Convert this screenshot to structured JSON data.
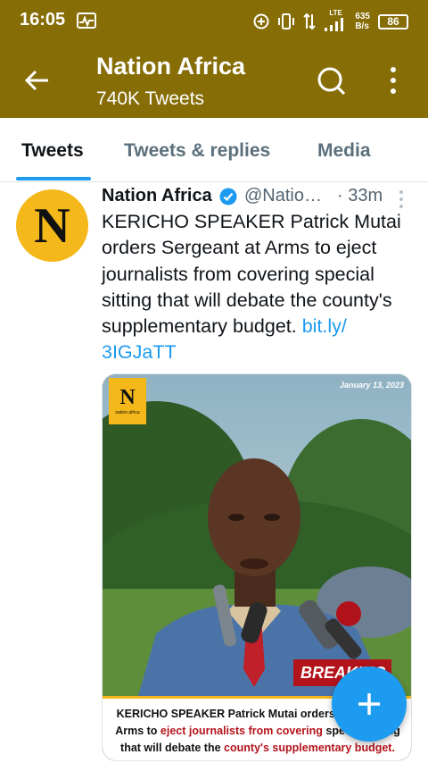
{
  "status_bar": {
    "time": "16:05",
    "network_type": "LTE",
    "speed_value": "635",
    "speed_unit": "B/s",
    "battery": "86",
    "icons": [
      "activity-icon",
      "add-circle-icon",
      "vibrate-icon",
      "data-arrows-icon",
      "signal-icon"
    ]
  },
  "app_bar": {
    "title": "Nation Africa",
    "subtitle": "740K Tweets",
    "icons": [
      "back-arrow-icon",
      "search-icon",
      "more-vertical-icon"
    ]
  },
  "tabs": [
    {
      "label": "Tweets",
      "active": true
    },
    {
      "label": "Tweets & replies",
      "active": false
    },
    {
      "label": "Media",
      "active": false
    }
  ],
  "tweet": {
    "avatar_letter": "N",
    "author": "Nation Africa",
    "handle": "@Natio…",
    "separator": "·",
    "time_ago": "33m",
    "text_line1": "KERICHO SPEAKER Patrick Mutai",
    "text_line2": "orders Sergeant at Arms to eject",
    "text_line3": "journalists from covering special",
    "text_line4": "sitting that will debate the county's",
    "text_line5": "supplementary budget.",
    "link_part1": "bit.ly/",
    "link_part2": "3IGJaTT",
    "media": {
      "logo_letter": "N",
      "logo_text": "nation.africa",
      "date": "January 13, 2023",
      "breaking": "BREAKING",
      "caption_line1": "KERICHO SPEAKER Patrick Mutai orders Sergeant at",
      "caption_line2_pre": "Arms to ",
      "caption_line2_red": "eject journalists from covering",
      "caption_line2_post": " special sitting",
      "caption_line3_pre": "that will debate the ",
      "caption_line3_red": "county's supplementary budget."
    }
  },
  "colors": {
    "app_bar": "#866d06",
    "accent": "#1d9bf0",
    "avatar": "#f5b81a",
    "breaking": "#b3131b"
  }
}
